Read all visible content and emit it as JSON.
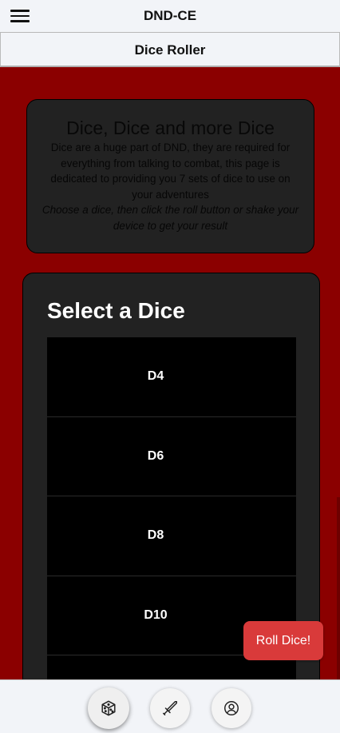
{
  "header": {
    "app_title": "DND-CE",
    "menu_icon": "hamburger-menu-icon"
  },
  "subheader": {
    "page_title": "Dice Roller"
  },
  "info": {
    "title": "Dice, Dice and more Dice",
    "description": "Dice are a huge part of DND, they are required for everything from talking to combat, this page is dedicated to providing you 7 sets of dice to use on your adventures",
    "hint": "Choose a dice, then click the roll button or shake your device to get your result"
  },
  "selector": {
    "title": "Select a Dice",
    "dice": [
      {
        "label": "D4"
      },
      {
        "label": "D6"
      },
      {
        "label": "D8"
      },
      {
        "label": "D10"
      },
      {
        "label": ""
      }
    ]
  },
  "roll_button": {
    "label": "Roll Dice!"
  },
  "bottom_nav": {
    "items": [
      {
        "icon": "dice-icon",
        "active": true
      },
      {
        "icon": "sword-icon",
        "active": false
      },
      {
        "icon": "user-circle-icon",
        "active": false
      }
    ]
  },
  "colors": {
    "background": "#8b0000",
    "card": "#222222",
    "accent": "#d93a3a"
  }
}
